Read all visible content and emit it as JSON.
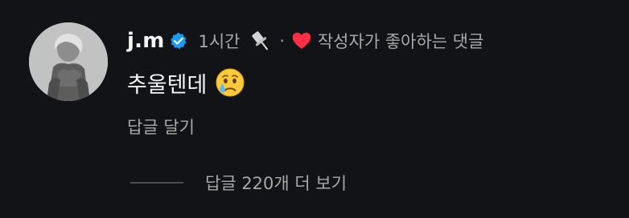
{
  "comment": {
    "username": "j.m",
    "time": "1시간",
    "separator": "·",
    "liked_by_author": "작성자가 좋아하는 댓글",
    "text": "추울텐데",
    "reply_label": "답글 달기",
    "view_replies_label": "답글 220개 더 보기",
    "icons": [
      "verified-badge-icon",
      "pin-icon",
      "heart-icon",
      "crying-face-emoji-icon"
    ],
    "colors": {
      "background": "#121316",
      "text_primary": "#f5f5f5",
      "text_secondary": "#a8a8a8",
      "verified_blue": "#1d9bf0",
      "heart_red": "#ff2d45"
    }
  }
}
